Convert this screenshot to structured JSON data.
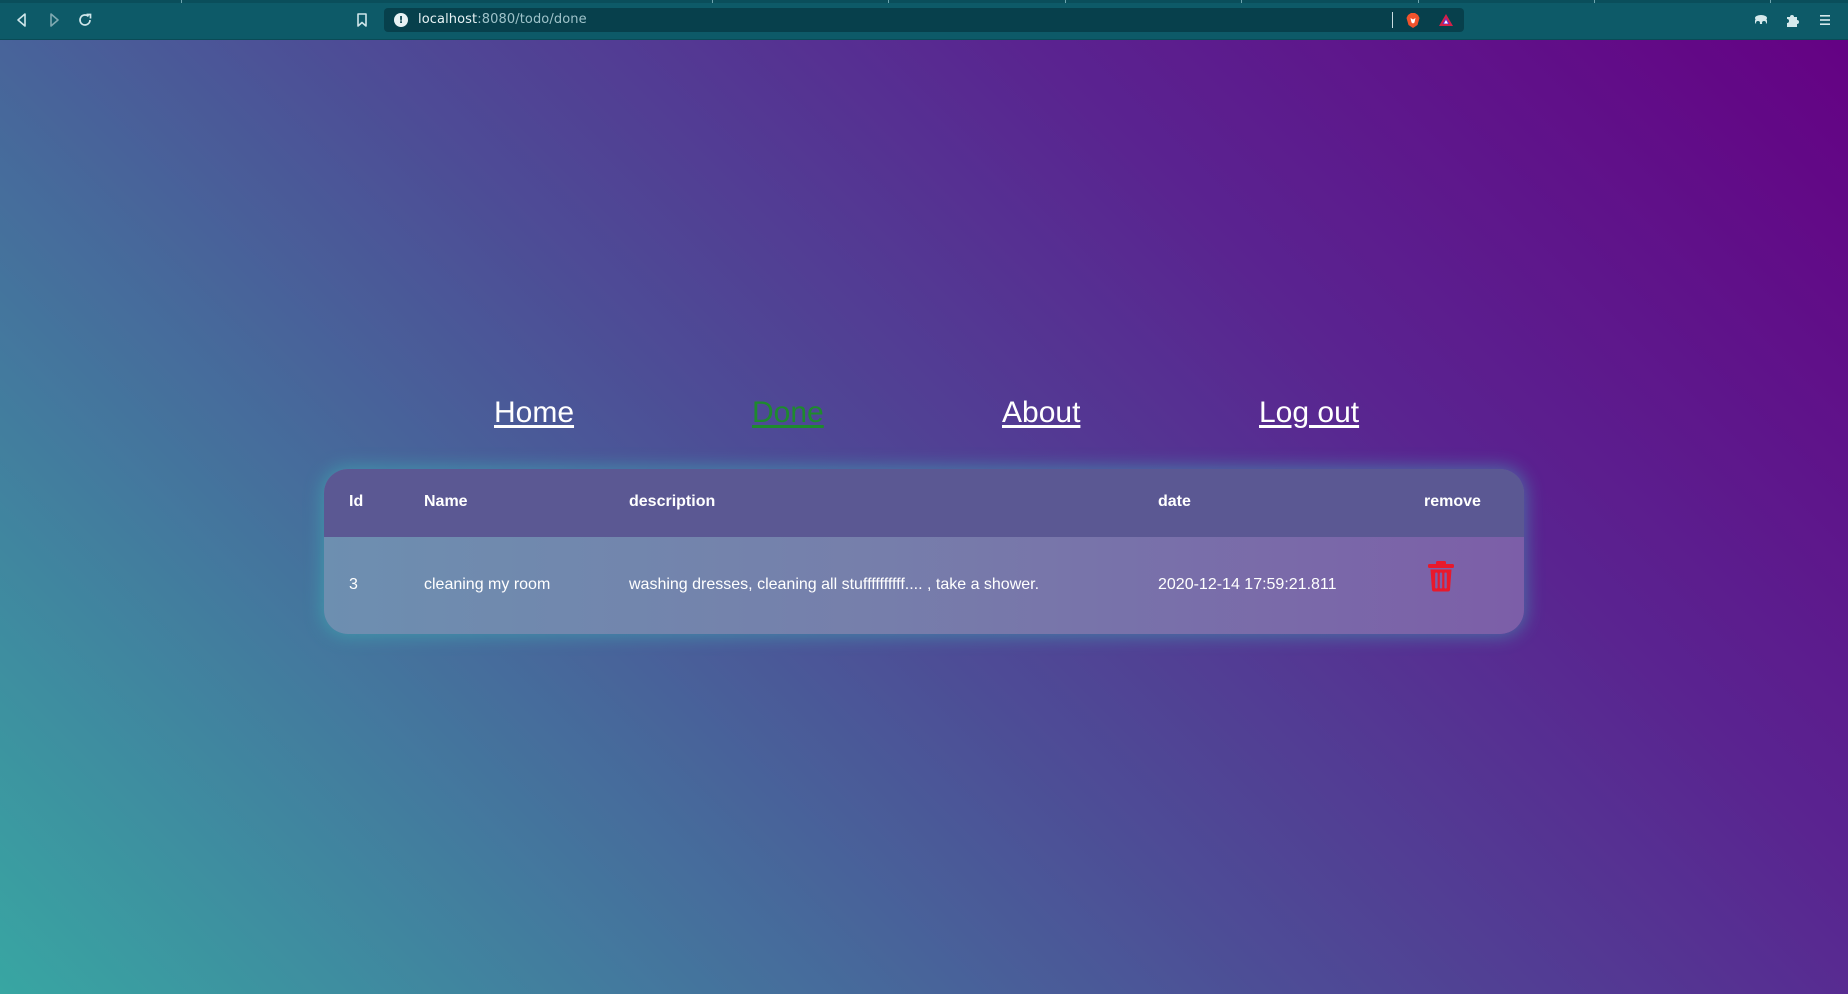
{
  "browser": {
    "url_host": "localhost",
    "url_path": ":8080/todo/done",
    "info_glyph": "!",
    "icons": [
      "back-icon",
      "forward-icon",
      "reload-icon",
      "bookmark-icon",
      "info-icon",
      "brave-shield-icon",
      "brave-rewards-icon",
      "vpn-icon",
      "extensions-icon",
      "menu-icon"
    ]
  },
  "nav": {
    "home": "Home",
    "done": "Done",
    "about": "About",
    "logout": "Log out",
    "active_color": "#1e8a2e"
  },
  "table": {
    "headers": [
      "Id",
      "Name",
      "description",
      "date",
      "remove"
    ],
    "rows": [
      {
        "id": "3",
        "name": "cleaning my room",
        "description": "washing dresses, cleaning all stuffffffffff.... , take a shower.",
        "date": "2020-12-14 17:59:21.811",
        "remove_icon": "trash-icon"
      }
    ],
    "remove_color": "#e8192c"
  }
}
